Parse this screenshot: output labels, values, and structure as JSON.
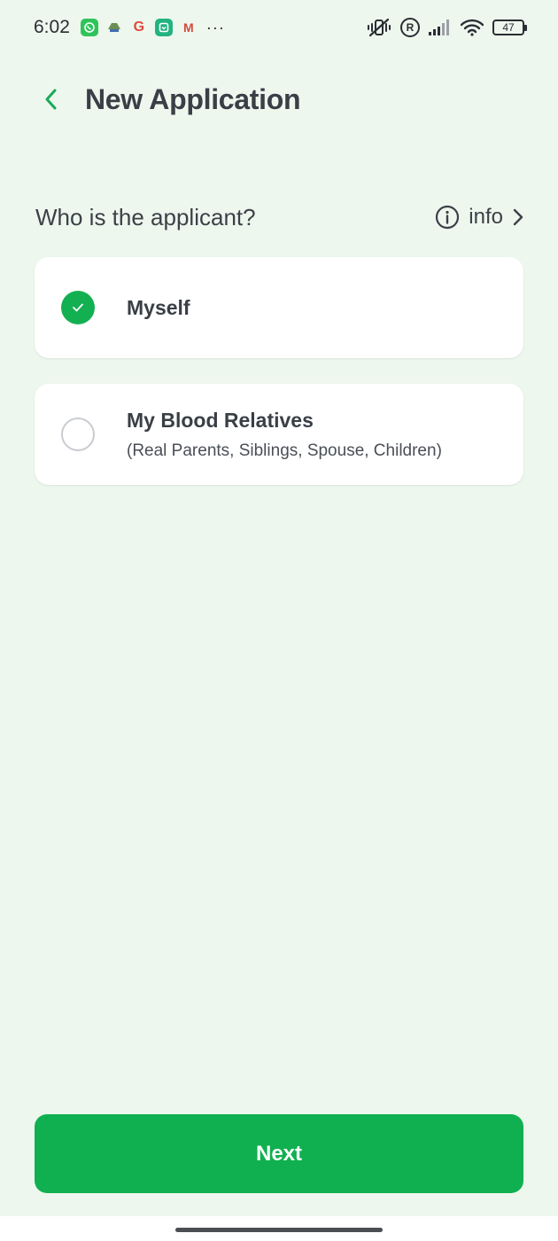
{
  "status_bar": {
    "time": "6:02",
    "app_icons": [
      "whatsapp-icon",
      "drive-icon",
      "google-icon",
      "mi-icon",
      "gmail-icon"
    ],
    "google_letter": "G",
    "gmail_letter": "M",
    "more": "···",
    "registered_mark": "R",
    "battery": "47"
  },
  "header": {
    "title": "New Application"
  },
  "question": {
    "text": "Who is the applicant?",
    "info_label": "info"
  },
  "options": [
    {
      "title": "Myself",
      "subtitle": "",
      "selected": true
    },
    {
      "title": "My Blood Relatives",
      "subtitle": "(Real Parents, Siblings, Spouse, Children)",
      "selected": false
    }
  ],
  "footer": {
    "next_label": "Next"
  },
  "colors": {
    "background": "#edf7ee",
    "accent": "#10b050",
    "back_arrow": "#1aa95a",
    "text": "#3c4148"
  }
}
